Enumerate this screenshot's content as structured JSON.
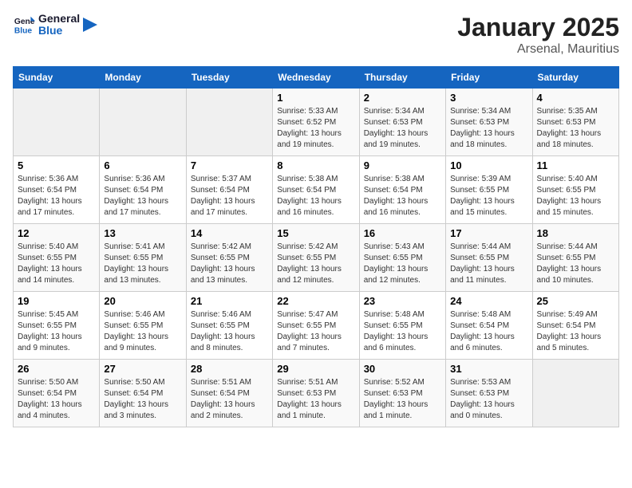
{
  "header": {
    "logo_line1": "General",
    "logo_line2": "Blue",
    "title": "January 2025",
    "subtitle": "Arsenal, Mauritius"
  },
  "weekdays": [
    "Sunday",
    "Monday",
    "Tuesday",
    "Wednesday",
    "Thursday",
    "Friday",
    "Saturday"
  ],
  "weeks": [
    [
      {
        "day": "",
        "info": ""
      },
      {
        "day": "",
        "info": ""
      },
      {
        "day": "",
        "info": ""
      },
      {
        "day": "1",
        "info": "Sunrise: 5:33 AM\nSunset: 6:52 PM\nDaylight: 13 hours\nand 19 minutes."
      },
      {
        "day": "2",
        "info": "Sunrise: 5:34 AM\nSunset: 6:53 PM\nDaylight: 13 hours\nand 19 minutes."
      },
      {
        "day": "3",
        "info": "Sunrise: 5:34 AM\nSunset: 6:53 PM\nDaylight: 13 hours\nand 18 minutes."
      },
      {
        "day": "4",
        "info": "Sunrise: 5:35 AM\nSunset: 6:53 PM\nDaylight: 13 hours\nand 18 minutes."
      }
    ],
    [
      {
        "day": "5",
        "info": "Sunrise: 5:36 AM\nSunset: 6:54 PM\nDaylight: 13 hours\nand 17 minutes."
      },
      {
        "day": "6",
        "info": "Sunrise: 5:36 AM\nSunset: 6:54 PM\nDaylight: 13 hours\nand 17 minutes."
      },
      {
        "day": "7",
        "info": "Sunrise: 5:37 AM\nSunset: 6:54 PM\nDaylight: 13 hours\nand 17 minutes."
      },
      {
        "day": "8",
        "info": "Sunrise: 5:38 AM\nSunset: 6:54 PM\nDaylight: 13 hours\nand 16 minutes."
      },
      {
        "day": "9",
        "info": "Sunrise: 5:38 AM\nSunset: 6:54 PM\nDaylight: 13 hours\nand 16 minutes."
      },
      {
        "day": "10",
        "info": "Sunrise: 5:39 AM\nSunset: 6:55 PM\nDaylight: 13 hours\nand 15 minutes."
      },
      {
        "day": "11",
        "info": "Sunrise: 5:40 AM\nSunset: 6:55 PM\nDaylight: 13 hours\nand 15 minutes."
      }
    ],
    [
      {
        "day": "12",
        "info": "Sunrise: 5:40 AM\nSunset: 6:55 PM\nDaylight: 13 hours\nand 14 minutes."
      },
      {
        "day": "13",
        "info": "Sunrise: 5:41 AM\nSunset: 6:55 PM\nDaylight: 13 hours\nand 13 minutes."
      },
      {
        "day": "14",
        "info": "Sunrise: 5:42 AM\nSunset: 6:55 PM\nDaylight: 13 hours\nand 13 minutes."
      },
      {
        "day": "15",
        "info": "Sunrise: 5:42 AM\nSunset: 6:55 PM\nDaylight: 13 hours\nand 12 minutes."
      },
      {
        "day": "16",
        "info": "Sunrise: 5:43 AM\nSunset: 6:55 PM\nDaylight: 13 hours\nand 12 minutes."
      },
      {
        "day": "17",
        "info": "Sunrise: 5:44 AM\nSunset: 6:55 PM\nDaylight: 13 hours\nand 11 minutes."
      },
      {
        "day": "18",
        "info": "Sunrise: 5:44 AM\nSunset: 6:55 PM\nDaylight: 13 hours\nand 10 minutes."
      }
    ],
    [
      {
        "day": "19",
        "info": "Sunrise: 5:45 AM\nSunset: 6:55 PM\nDaylight: 13 hours\nand 9 minutes."
      },
      {
        "day": "20",
        "info": "Sunrise: 5:46 AM\nSunset: 6:55 PM\nDaylight: 13 hours\nand 9 minutes."
      },
      {
        "day": "21",
        "info": "Sunrise: 5:46 AM\nSunset: 6:55 PM\nDaylight: 13 hours\nand 8 minutes."
      },
      {
        "day": "22",
        "info": "Sunrise: 5:47 AM\nSunset: 6:55 PM\nDaylight: 13 hours\nand 7 minutes."
      },
      {
        "day": "23",
        "info": "Sunrise: 5:48 AM\nSunset: 6:55 PM\nDaylight: 13 hours\nand 6 minutes."
      },
      {
        "day": "24",
        "info": "Sunrise: 5:48 AM\nSunset: 6:54 PM\nDaylight: 13 hours\nand 6 minutes."
      },
      {
        "day": "25",
        "info": "Sunrise: 5:49 AM\nSunset: 6:54 PM\nDaylight: 13 hours\nand 5 minutes."
      }
    ],
    [
      {
        "day": "26",
        "info": "Sunrise: 5:50 AM\nSunset: 6:54 PM\nDaylight: 13 hours\nand 4 minutes."
      },
      {
        "day": "27",
        "info": "Sunrise: 5:50 AM\nSunset: 6:54 PM\nDaylight: 13 hours\nand 3 minutes."
      },
      {
        "day": "28",
        "info": "Sunrise: 5:51 AM\nSunset: 6:54 PM\nDaylight: 13 hours\nand 2 minutes."
      },
      {
        "day": "29",
        "info": "Sunrise: 5:51 AM\nSunset: 6:53 PM\nDaylight: 13 hours\nand 1 minute."
      },
      {
        "day": "30",
        "info": "Sunrise: 5:52 AM\nSunset: 6:53 PM\nDaylight: 13 hours\nand 1 minute."
      },
      {
        "day": "31",
        "info": "Sunrise: 5:53 AM\nSunset: 6:53 PM\nDaylight: 13 hours\nand 0 minutes."
      },
      {
        "day": "",
        "info": ""
      }
    ]
  ]
}
